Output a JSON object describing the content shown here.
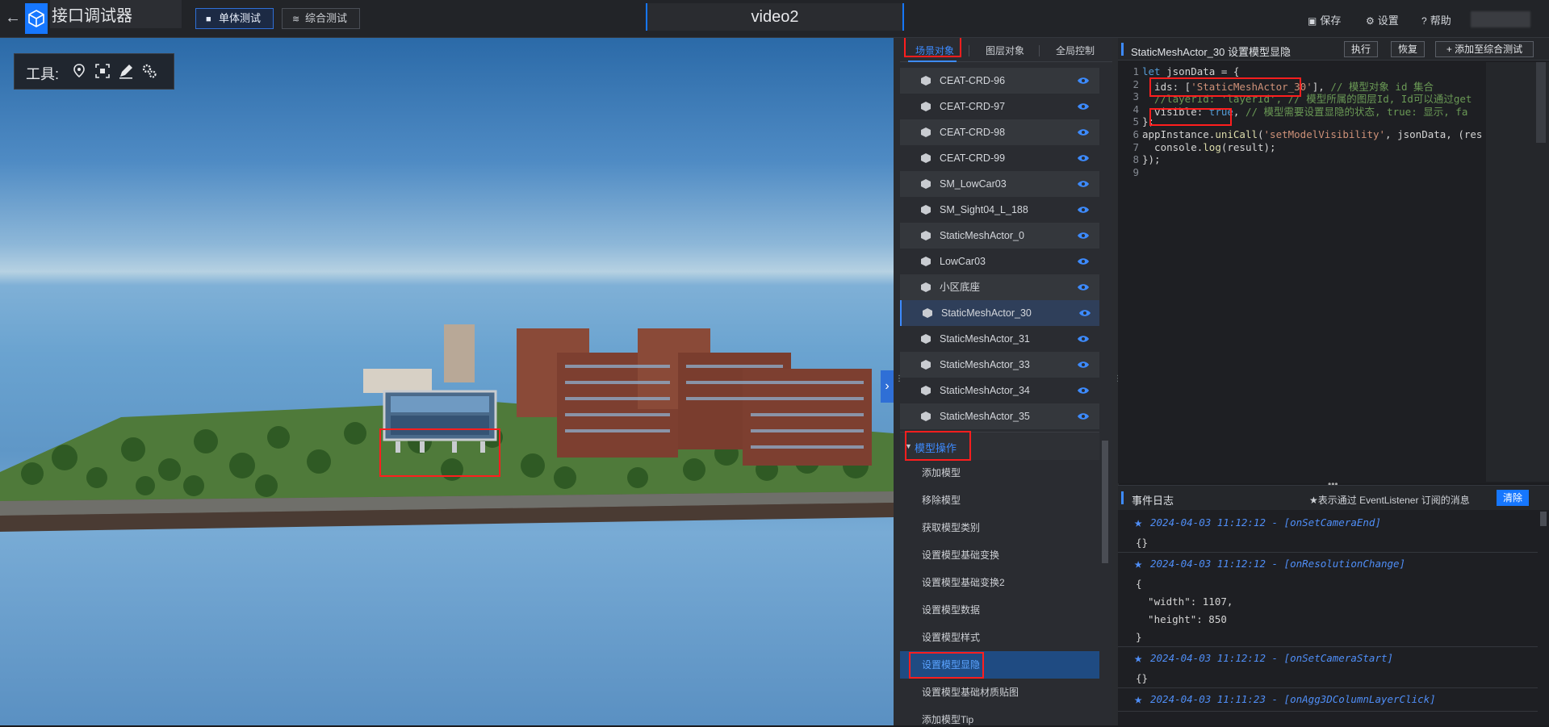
{
  "header": {
    "app_title": "接口调试器",
    "tab_single": "单体测试",
    "tab_combined": "综合测试",
    "video_title": "video2",
    "save": "保存",
    "settings": "设置",
    "help": "帮助"
  },
  "viewport": {
    "tools_label": "工具:"
  },
  "scene_panel": {
    "tabs": [
      "场景对象",
      "图层对象",
      "全局控制"
    ],
    "items": [
      "CEAT-CRD-96",
      "CEAT-CRD-97",
      "CEAT-CRD-98",
      "CEAT-CRD-99",
      "SM_LowCar03",
      "SM_Sight04_L_188",
      "StaticMeshActor_0",
      "LowCar03",
      "小区底座",
      "StaticMeshActor_30",
      "StaticMeshActor_31",
      "StaticMeshActor_33",
      "StaticMeshActor_34",
      "StaticMeshActor_35"
    ],
    "group_title": "模型操作",
    "operations": [
      "添加模型",
      "移除模型",
      "获取模型类别",
      "设置模型基础变换",
      "设置模型基础变换2",
      "设置模型数据",
      "设置模型样式",
      "设置模型显隐",
      "设置模型基础材质贴图",
      "添加模型Tip"
    ]
  },
  "editor": {
    "title": "StaticMeshActor_30 设置模型显隐",
    "run": "执行",
    "restore": "恢复",
    "add_to_combined": "添加至综合测试",
    "lines": [
      {
        "n": "1",
        "segs": [
          [
            "kw",
            "let "
          ],
          [
            "",
            "jsonData = {"
          ]
        ]
      },
      {
        "n": "2",
        "segs": [
          [
            "",
            "  ids: ["
          ],
          [
            "str",
            "'StaticMeshActor_30'"
          ],
          [
            "",
            "], "
          ],
          [
            "cm",
            "// 模型对象 id 集合"
          ]
        ]
      },
      {
        "n": "3",
        "segs": [
          [
            "cm",
            "  //layerId: 'layerId', // 模型所属的图层Id, Id可以通过get"
          ]
        ]
      },
      {
        "n": "4",
        "segs": [
          [
            "",
            "  visible: "
          ],
          [
            "kw",
            "true"
          ],
          [
            "",
            ", "
          ],
          [
            "cm",
            "// 模型需要设置显隐的状态, true: 显示, fa"
          ]
        ]
      },
      {
        "n": "5",
        "segs": [
          [
            "",
            "};"
          ]
        ]
      },
      {
        "n": "6",
        "segs": [
          [
            "",
            "appInstance."
          ],
          [
            "fn",
            "uniCall"
          ],
          [
            "",
            "("
          ],
          [
            "str",
            "'setModelVisibility'"
          ],
          [
            "",
            ", jsonData, (res"
          ]
        ]
      },
      {
        "n": "7",
        "segs": [
          [
            "",
            "  console."
          ],
          [
            "fn",
            "log"
          ],
          [
            "",
            "(result);"
          ]
        ]
      },
      {
        "n": "8",
        "segs": [
          [
            "",
            "});"
          ]
        ]
      },
      {
        "n": "9",
        "segs": [
          [
            "",
            ""
          ]
        ]
      }
    ]
  },
  "event_log": {
    "title": "事件日志",
    "note": "★表示通过 EventListener 订阅的消息",
    "clear": "清除",
    "entries": [
      {
        "head": "2024-04-03 11:12:12 - [onSetCameraEnd]",
        "body": [
          "{}"
        ]
      },
      {
        "head": "2024-04-03 11:12:12 - [onResolutionChange]",
        "body": [
          "{",
          "  \"width\": 1107,",
          "  \"height\": 850",
          "}"
        ]
      },
      {
        "head": "2024-04-03 11:12:12 - [onSetCameraStart]",
        "body": [
          "{}"
        ]
      },
      {
        "head": "2024-04-03 11:11:23 - [onAgg3DColumnLayerClick]",
        "body": []
      }
    ]
  },
  "colors": {
    "accent": "#1677ff",
    "highlight_box": "#ff1e1e",
    "link_blue": "#3d8bff"
  }
}
